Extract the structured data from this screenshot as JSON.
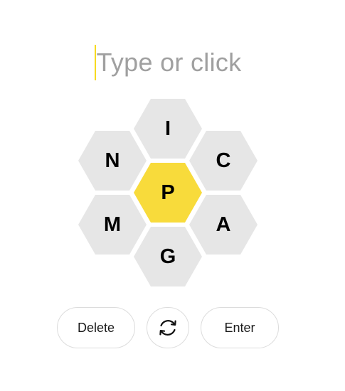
{
  "input": {
    "placeholder": "Type or click",
    "value": ""
  },
  "hive": {
    "center_letter": "P",
    "outer_letters": {
      "top": "I",
      "upper_left": "N",
      "upper_right": "C",
      "lower_left": "M",
      "lower_right": "A",
      "bottom": "G"
    }
  },
  "controls": {
    "delete_label": "Delete",
    "shuffle_icon": "shuffle-icon",
    "enter_label": "Enter"
  },
  "colors": {
    "center_cell": "#f8db3b",
    "outer_cell": "#e6e6e6",
    "caret": "#f7da21",
    "placeholder_text": "#a0a0a0",
    "button_border": "#dcdcdc"
  }
}
